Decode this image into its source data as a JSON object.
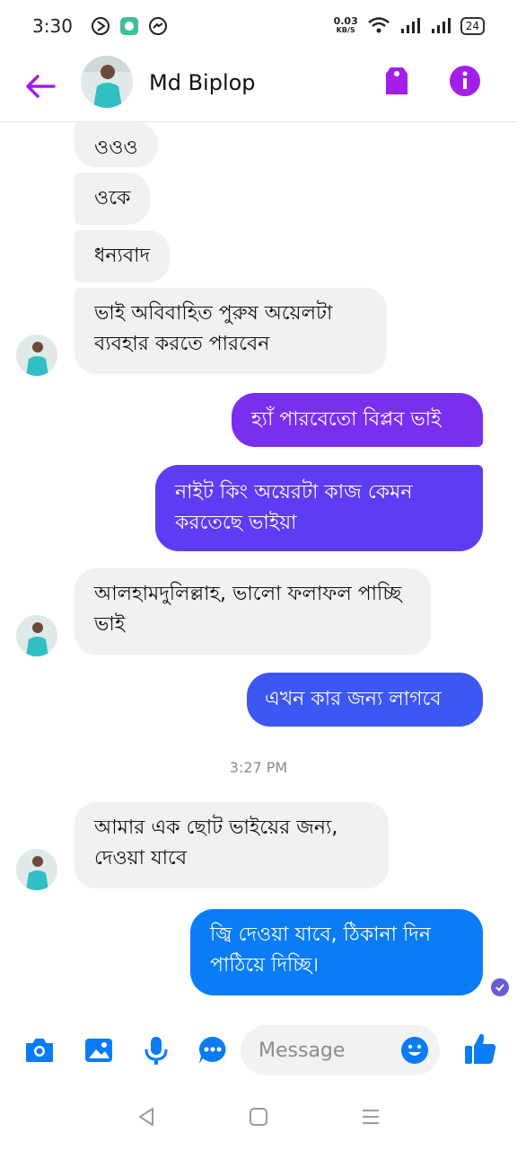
{
  "status_bar": {
    "time": "3:30",
    "net_speed_value": "0.03",
    "net_speed_unit": "KB/S",
    "battery": "24"
  },
  "header": {
    "contact_name": "Md Biplop"
  },
  "messages": [
    {
      "side": "in",
      "text": "ওওও"
    },
    {
      "side": "in",
      "text": "ওকে"
    },
    {
      "side": "in",
      "text": "ধন্যবাদ"
    },
    {
      "side": "in",
      "text": "ভাই অবিবাহিত পুরুষ অয়েলটা ব্যবহার করতে পারবেন"
    },
    {
      "side": "out",
      "text": "হ্যাঁ পারবেতো বিপ্লব ভাই"
    },
    {
      "side": "out",
      "text": "নাইট কিং অয়েরটা কাজ কেমন করতেছে ভাইয়া"
    },
    {
      "side": "in",
      "text": "আলহামদুলিল্লাহ, ভালো ফলাফল পাচ্ছি ভাই"
    },
    {
      "side": "out",
      "text": "এখন কার জন্য লাগবে"
    },
    {
      "side": "in",
      "text": "আমার এক ছোট ভাইয়ের জন্য, দেওয়া যাবে"
    },
    {
      "side": "out",
      "text": "জ্বি দেওয়া যাবে, ঠিকানা দিন পাঠিয়ে দিচ্ছি।"
    }
  ],
  "timestamp": "3:27 PM",
  "composer": {
    "placeholder": "Message"
  },
  "colors": {
    "accent": "#a31ee8",
    "out_purple": "#7a2ff0",
    "out_violet": "#5f3bf3",
    "out_blue": "#3d57f2",
    "out_final": "#0a7cf5",
    "composer_icon": "#0a7cf5"
  },
  "icons": {
    "back": "arrow-left-icon",
    "tag": "tag-icon",
    "info": "info-icon",
    "camera": "camera-icon",
    "image": "image-icon",
    "mic": "microphone-icon",
    "more": "more-icon",
    "emoji": "emoji-icon",
    "like": "thumbs-up-icon"
  }
}
